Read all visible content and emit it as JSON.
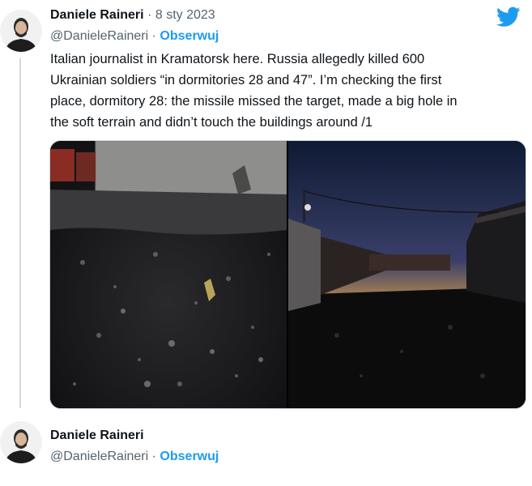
{
  "tweets": [
    {
      "name": "Daniele Raineri",
      "separator": "·",
      "date": "8 sty 2023",
      "handle": "@DanieleRaineri",
      "follow_label": "Obserwuj",
      "avatar_icon": "person-avatar-icon",
      "text": "Italian journalist in Kramatorsk here. Russia allegedly killed 600\nUkrainian soldiers “in dormitories 28 and 47”. I’m checking the first\nplace, dormitory 28: the missile missed the target, made a big hole in\nthe soft terrain and didn’t touch the buildings around /1",
      "media": [
        "crater-photo",
        "sunset-alley-photo"
      ]
    },
    {
      "name": "Daniele Raineri",
      "separator": "·",
      "handle": "@DanieleRaineri",
      "follow_label": "Obserwuj",
      "avatar_icon": "person-avatar-icon"
    }
  ],
  "brand": {
    "logo_icon": "twitter-bird-icon",
    "accent": "#1d9bf0"
  }
}
